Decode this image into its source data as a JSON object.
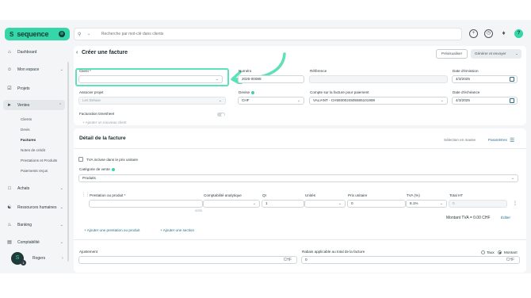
{
  "app": {
    "brand": "sequence",
    "brand_badge": "⊕"
  },
  "search": {
    "placeholder": "Recherche par mot-clé dans clients"
  },
  "topbar": {
    "avatar_letter": "?"
  },
  "sidebar": {
    "items": [
      {
        "label": "Dashboard",
        "icon": "home-icon"
      },
      {
        "label": "Mon espace",
        "icon": "user-icon"
      },
      {
        "label": "Projets",
        "icon": "check-square-icon"
      },
      {
        "label": "Ventes",
        "icon": "tag-icon"
      },
      {
        "label": "Achats",
        "icon": "bag-icon"
      },
      {
        "label": "Ressources humaines",
        "icon": "hr-icon"
      },
      {
        "label": "Banking",
        "icon": "bank-icon"
      },
      {
        "label": "Comptabilité",
        "icon": "ledger-icon"
      }
    ],
    "subitems": [
      "Clients",
      "Devis",
      "Factures",
      "Notes de crédit",
      "Prestations et Produits",
      "Paiements reçus"
    ],
    "user": {
      "name": "Rogers",
      "badge": "1"
    }
  },
  "page": {
    "title": "Créer une facture",
    "draft_button": "Prévisualiser",
    "generate_button": "Générer et envoyer"
  },
  "form": {
    "client_label": "Client *",
    "client_value": "",
    "number_label": "Numéro",
    "number_value": "2025-00088",
    "reference_label": "Référence",
    "reference_value": "",
    "issue_date_label": "Date d'émission",
    "issue_date_value": "4/3/2025",
    "associated_project_label": "Associer projet",
    "associated_project_placeholder": "Les Deluxe",
    "currency_label": "Devise",
    "currency_value": "CHF",
    "account_label": "Compte sur la facture pour paiement",
    "account_value": "VALIANT - CH5930024505585101908",
    "due_date_label": "Date d'échéance",
    "due_date_value": "4/3/2025",
    "timesheet_label": "Facturation timesheet",
    "add_client_link": "+ Ajouter un nouveau client"
  },
  "details": {
    "title": "Détail de la facture",
    "stock_link": "Sélection en masse",
    "params_link": "Paramètres",
    "vat_included_label": "TVA incluse dans le prix unitaire",
    "sales_category_label": "Catégorie de vente",
    "sales_category_value": "Produits",
    "columns": [
      "Prestation ou produit *",
      "Comptabilité analytique",
      "Qt",
      "Unités",
      "Prix unitaire",
      "TVA (%)",
      "Total HT"
    ],
    "row": {
      "product": "",
      "analytics": "",
      "qty": "1",
      "units": "",
      "unit_price": "0",
      "vat": "8.1%",
      "total": "0"
    },
    "row_note": "0/255",
    "vat_amount_label": "Montant TVA = 0.00 CHF",
    "edit_link": "Éditer",
    "add_service_link": "+ Ajouter une prestation ou produit",
    "add_section_link": "+ Ajouter une section",
    "adjustment_label": "Ajustement",
    "adjustment_currency": "CHF",
    "discount_label": "Rabais applicable au total de la facture",
    "discount_value": "0",
    "discount_currency": "CHF",
    "rate_option": "Taux",
    "amount_option": "Montant"
  }
}
